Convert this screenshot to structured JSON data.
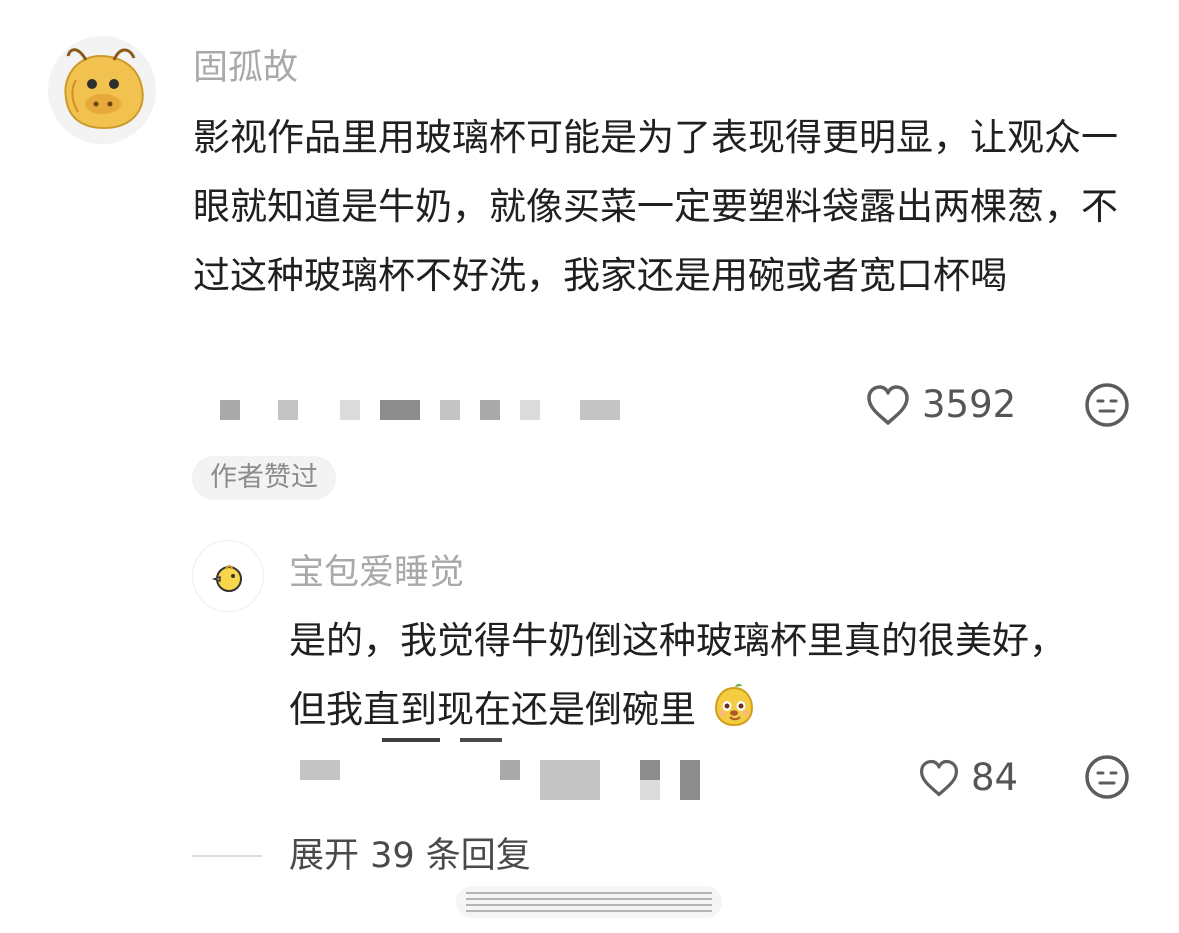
{
  "comment": {
    "username": "固孤故",
    "text": "影视作品里用玻璃杯可能是为了表现得更明显，让观众一眼就知道是牛奶，就像买菜一定要塑料袋露出两棵葱，不过这种玻璃杯不好洗，我家还是用碗或者宽口杯喝",
    "likes": "3592",
    "author_liked_label": "作者赞过",
    "icons": {
      "avatar": "cow-avatar-icon",
      "like": "heart-icon",
      "reaction": "neutral-face-icon"
    }
  },
  "reply": {
    "username": "宝包爱睡觉",
    "text": "是的，我觉得牛奶倒这种玻璃杯里真的很美好，但我直到现在还是倒碗里",
    "likes": "84",
    "icons": {
      "avatar": "duck-avatar-icon",
      "emoji": "smiling-mango-emoji",
      "like": "heart-icon",
      "reaction": "neutral-face-icon"
    }
  },
  "expand_replies": "展开 39 条回复",
  "colors": {
    "muted_text": "#a9a9a9",
    "body_text": "#202020",
    "avatar_fill": "#f1c24f"
  }
}
